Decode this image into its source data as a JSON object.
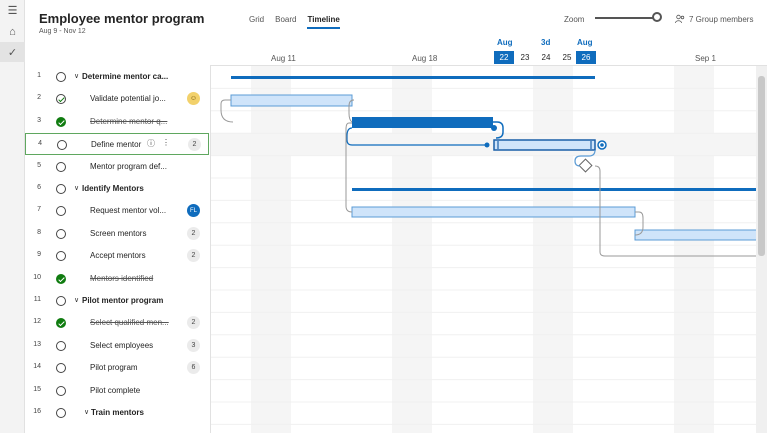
{
  "app": {
    "title": "Employee mentor program",
    "subtitle": "Aug 9 - Nov 12"
  },
  "views": [
    {
      "label": "Grid",
      "active": false
    },
    {
      "label": "Board",
      "active": false
    },
    {
      "label": "Timeline",
      "active": true
    }
  ],
  "zoom": {
    "label": "Zoom",
    "value": 1.0
  },
  "members": {
    "label": "7 Group members"
  },
  "timeline": {
    "week_labels": [
      "Aug 11",
      "Aug 18",
      "Sep 1"
    ],
    "month_top": [
      "Aug",
      "3d",
      "Aug"
    ],
    "days": [
      "22",
      "23",
      "24",
      "25",
      "26"
    ],
    "selected_days": [
      "22",
      "26"
    ]
  },
  "tasks": [
    {
      "num": "1",
      "name": "Determine mentor ca...",
      "summary": true,
      "status": "open",
      "badge": ""
    },
    {
      "num": "2",
      "name": "Validate potential jo...",
      "summary": false,
      "status": "partial",
      "badge": "pic"
    },
    {
      "num": "3",
      "name": "Determine mentor q...",
      "summary": false,
      "status": "done",
      "badge": ""
    },
    {
      "num": "4",
      "name": "Define mentor",
      "summary": false,
      "status": "open",
      "badge": "2",
      "selected": true
    },
    {
      "num": "5",
      "name": "Mentor program def...",
      "summary": false,
      "status": "open",
      "badge": ""
    },
    {
      "num": "6",
      "name": "Identify Mentors",
      "summary": true,
      "status": "open",
      "badge": ""
    },
    {
      "num": "7",
      "name": "Request mentor vol...",
      "summary": false,
      "status": "open",
      "badge": "FL"
    },
    {
      "num": "8",
      "name": "Screen mentors",
      "summary": false,
      "status": "open",
      "badge": "2"
    },
    {
      "num": "9",
      "name": "Accept mentors",
      "summary": false,
      "status": "open",
      "badge": "2"
    },
    {
      "num": "10",
      "name": "Mentors identified",
      "summary": false,
      "status": "done",
      "badge": ""
    },
    {
      "num": "11",
      "name": "Pilot mentor program",
      "summary": true,
      "status": "open",
      "badge": ""
    },
    {
      "num": "12",
      "name": "Select qualified men...",
      "summary": false,
      "status": "done",
      "badge": "2"
    },
    {
      "num": "13",
      "name": "Select employees",
      "summary": false,
      "status": "open",
      "badge": "3"
    },
    {
      "num": "14",
      "name": "Pilot program",
      "summary": false,
      "status": "open",
      "badge": "6"
    },
    {
      "num": "15",
      "name": "Pilot complete",
      "summary": false,
      "status": "open",
      "badge": ""
    },
    {
      "num": "16",
      "name": "Train mentors",
      "summary": true,
      "status": "open",
      "badge": ""
    }
  ],
  "colors": {
    "accent": "#0f6cbd",
    "bar_fill": "#cfe4fa",
    "bar_border": "#5b9bd5",
    "done_green": "#107c10",
    "weekend_shade": "#f5f5f5"
  }
}
